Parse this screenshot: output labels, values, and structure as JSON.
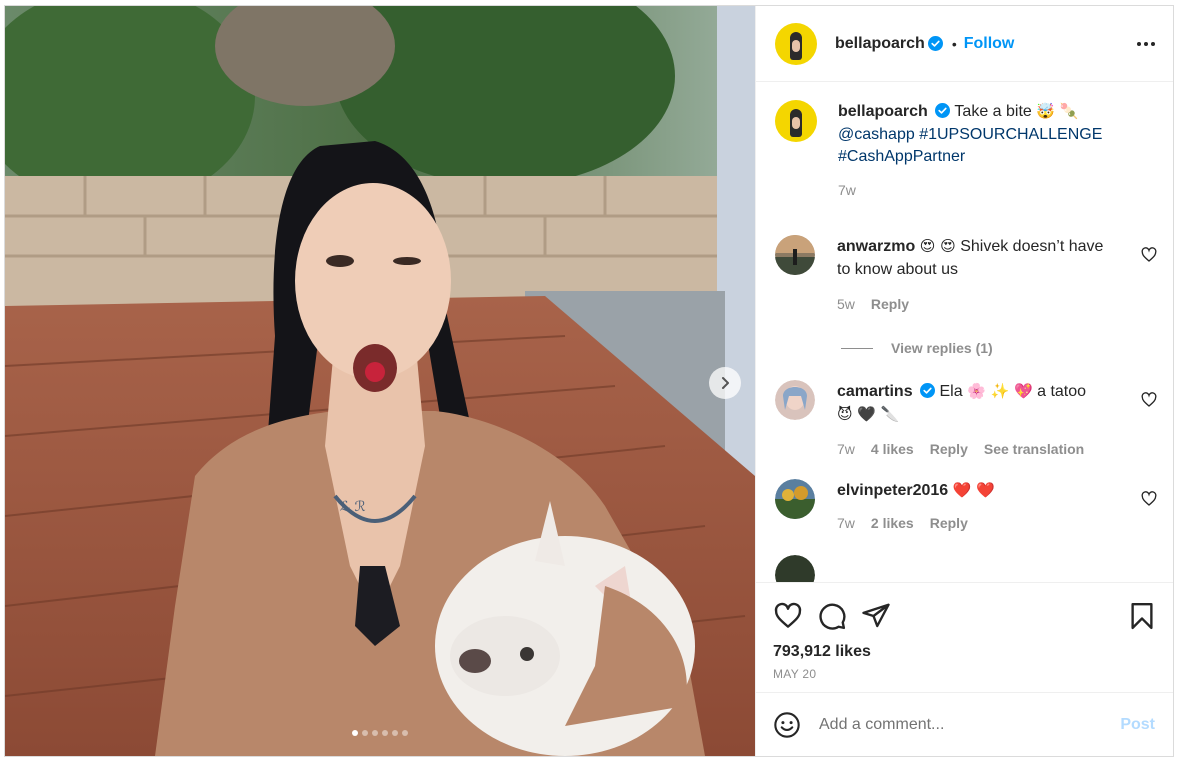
{
  "post": {
    "media": {
      "carousel_total": 6,
      "carousel_active": 1
    },
    "header": {
      "username": "bellapoarch",
      "separator": "•",
      "follow_label": "Follow"
    },
    "caption": {
      "username": "bellapoarch",
      "text": "Take a bite",
      "emoji": "🤯 🍡",
      "mention": "@cashapp",
      "hashtag1": "#1UPSOURCHALLENGE",
      "hashtag2": "#CashAppPartner",
      "time": "7w"
    },
    "comments": [
      {
        "username": "anwarzmo",
        "emoji": "😍 😍",
        "text": "Shivek doesn’t have to know about us",
        "time": "5w",
        "likes": "",
        "reply": "Reply",
        "replies_label": "View replies (1)"
      },
      {
        "username": "camartins",
        "verified": true,
        "text_prefix": "Ela",
        "emoji_mid": "🌸 ✨ 💖",
        "text_suffix": "a tatoo",
        "emoji_tail": "😈 🖤 🔪",
        "time": "7w",
        "likes": "4 likes",
        "reply": "Reply",
        "translate": "See translation"
      },
      {
        "username": "elvinpeter2016",
        "emoji": "❤️ ❤️",
        "time": "7w",
        "likes": "2 likes",
        "reply": "Reply"
      }
    ],
    "likes": "793,912 likes",
    "date": "MAY 20",
    "add_comment_placeholder": "Add a comment...",
    "post_label": "Post"
  },
  "colors": {
    "accent": "#0095f6",
    "verified": "#0095f6",
    "link": "#00376b",
    "muted": "#8e8e8e",
    "heart_red": "#ff3040"
  }
}
